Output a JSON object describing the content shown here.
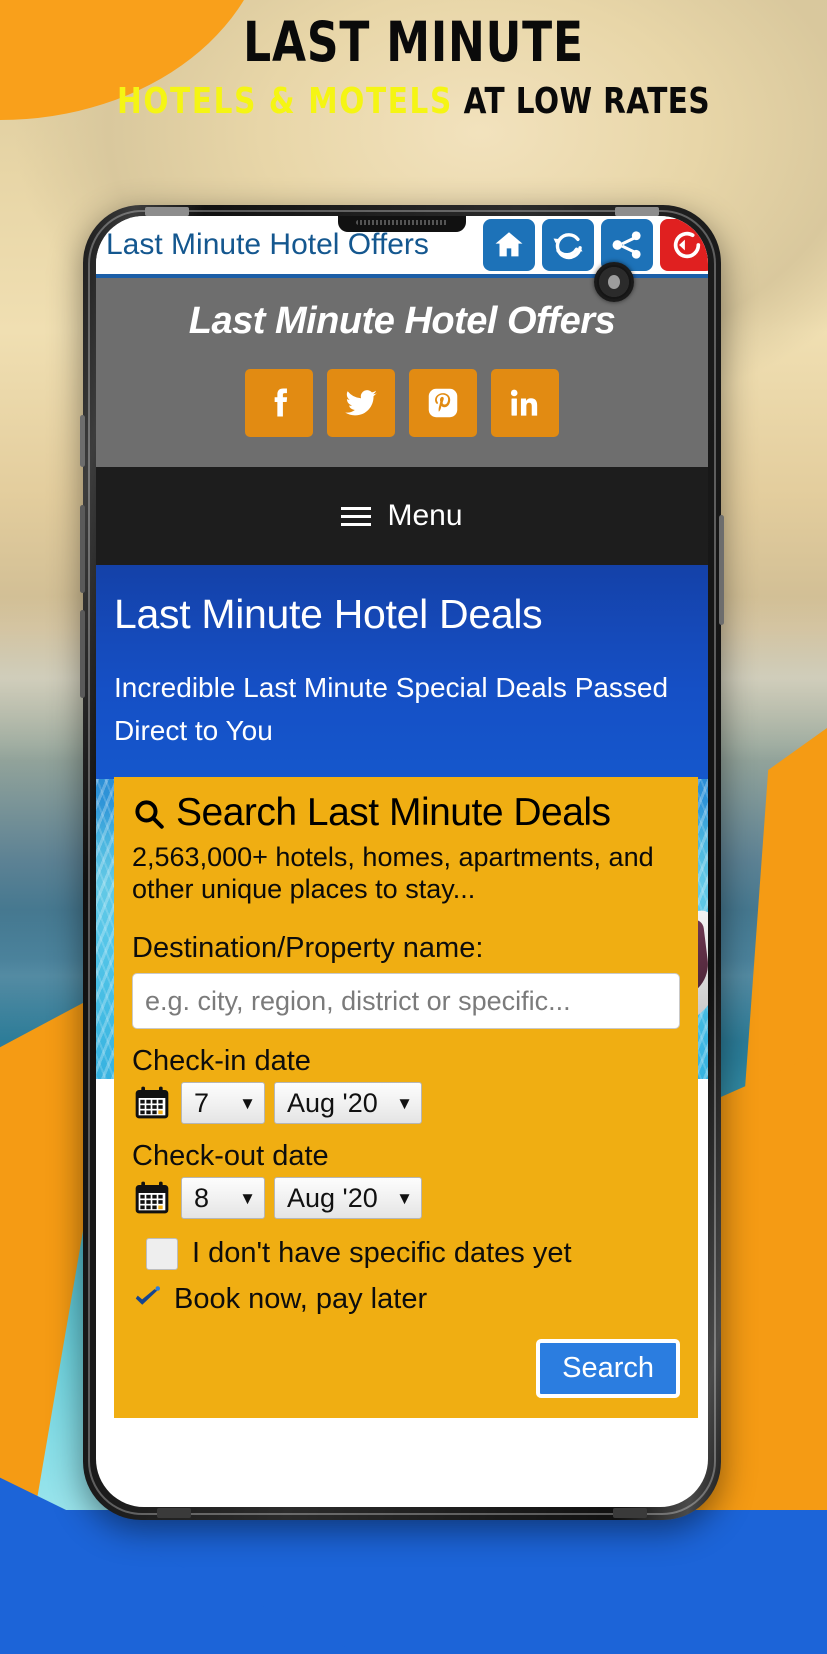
{
  "poster": {
    "headline_line1": "LAST MINUTE",
    "headline_line2_highlight": "HOTELS & MOTELS",
    "headline_line2_rest": "AT LOW RATES",
    "highlight_color": "#F5F514",
    "headline_color": "#0a0a0a",
    "bg_orange": "#F59B14",
    "bg_blue": "#1C64D8"
  },
  "browser_bar": {
    "page_title": "Last Minute Hotel Offers",
    "icons": [
      {
        "name": "home-icon",
        "color": "#1d72b8"
      },
      {
        "name": "refresh-icon",
        "color": "#1d72b8"
      },
      {
        "name": "share-icon",
        "color": "#1d72b8"
      },
      {
        "name": "exit-icon",
        "color": "#e02020"
      }
    ]
  },
  "site_header": {
    "title": "Last Minute Hotel Offers",
    "bg_color": "#6e6e6e",
    "social": [
      {
        "name": "facebook-icon",
        "label": "f"
      },
      {
        "name": "twitter-icon",
        "label": "t"
      },
      {
        "name": "pinterest-icon",
        "label": "P"
      },
      {
        "name": "linkedin-icon",
        "label": "in"
      }
    ],
    "social_tile_color": "#E28B12"
  },
  "menu": {
    "label": "Menu",
    "bg_color": "#1d1d1d"
  },
  "hero": {
    "heading": "Last Minute Hotel Deals",
    "subheading": "Incredible Last Minute Special Deals Passed Direct to You",
    "bg_color": "#1549B8"
  },
  "search_card": {
    "bg_color": "#F0AE12",
    "title": "Search Last Minute Deals",
    "subtitle": "2,563,000+ hotels, homes, apartments, and other unique places to stay...",
    "destination_label": "Destination/Property name:",
    "destination_value": "",
    "destination_placeholder": "e.g. city, region, district or specific...",
    "checkin": {
      "label": "Check-in date",
      "day": "7",
      "month": "Aug '20"
    },
    "checkout": {
      "label": "Check-out date",
      "day": "8",
      "month": "Aug '20"
    },
    "no_dates_label": "I don't have specific dates yet",
    "no_dates_checked": false,
    "book_now_label": "Book now, pay later",
    "book_now_checked": true,
    "search_button": "Search",
    "search_button_color": "#2B7DE0"
  }
}
